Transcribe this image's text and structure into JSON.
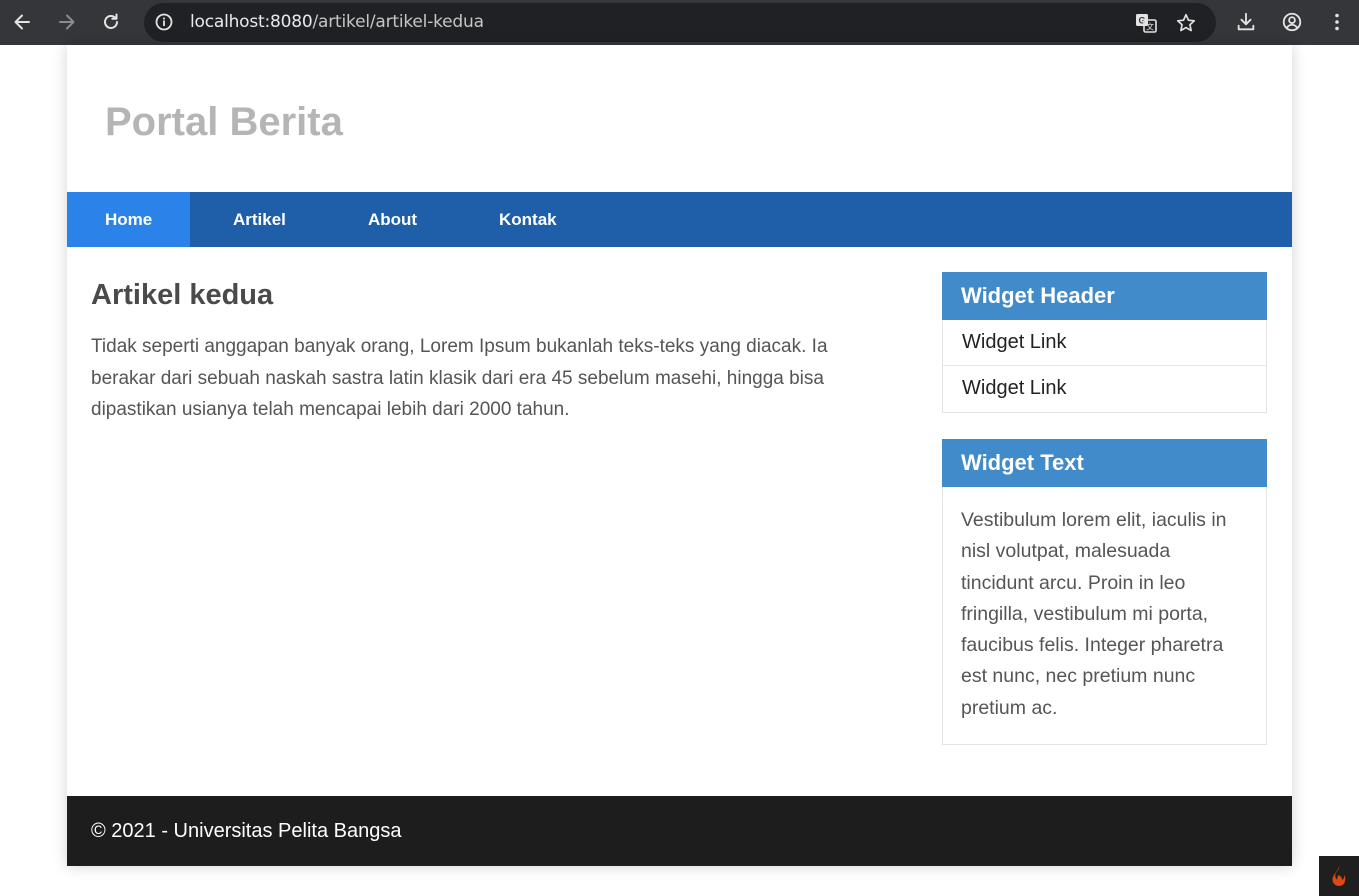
{
  "browser": {
    "url_host": "localhost:8080",
    "url_path": "/artikel/artikel-kedua",
    "icons": [
      "back-icon",
      "forward-icon",
      "reload-icon",
      "info-icon",
      "translate-icon",
      "star-icon",
      "download-icon",
      "profile-icon",
      "menu-dots-icon"
    ]
  },
  "header": {
    "title": "Portal Berita"
  },
  "nav": {
    "items": [
      {
        "label": "Home",
        "active": true
      },
      {
        "label": "Artikel",
        "active": false
      },
      {
        "label": "About",
        "active": false
      },
      {
        "label": "Kontak",
        "active": false
      }
    ]
  },
  "article": {
    "title": "Artikel kedua",
    "body": "Tidak seperti anggapan banyak orang, Lorem Ipsum bukanlah teks-teks yang diacak. Ia berakar dari sebuah naskah sastra latin klasik dari era 45 sebelum masehi, hingga bisa dipastikan usianya telah mencapai lebih dari 2000 tahun."
  },
  "sidebar": {
    "widget1": {
      "header": "Widget Header",
      "links": [
        "Widget Link",
        "Widget Link"
      ]
    },
    "widget2": {
      "header": "Widget Text",
      "text": "Vestibulum lorem elit, iaculis in nisl volutpat, malesuada tincidunt arcu. Proin in leo fringilla, vestibulum mi porta, faucibus felis. Integer pharetra est nunc, nec pretium nunc pretium ac."
    }
  },
  "footer": {
    "text": "© 2021 - Universitas Pelita Bangsa"
  },
  "colors": {
    "chrome_bg": "#35363a",
    "omnibox_bg": "#202124",
    "nav_bg": "#1f5faa",
    "nav_active": "#2b83ea",
    "widget_header": "#428bca",
    "footer_bg": "#1d1d1d",
    "title_gray": "#b5b5b5"
  }
}
